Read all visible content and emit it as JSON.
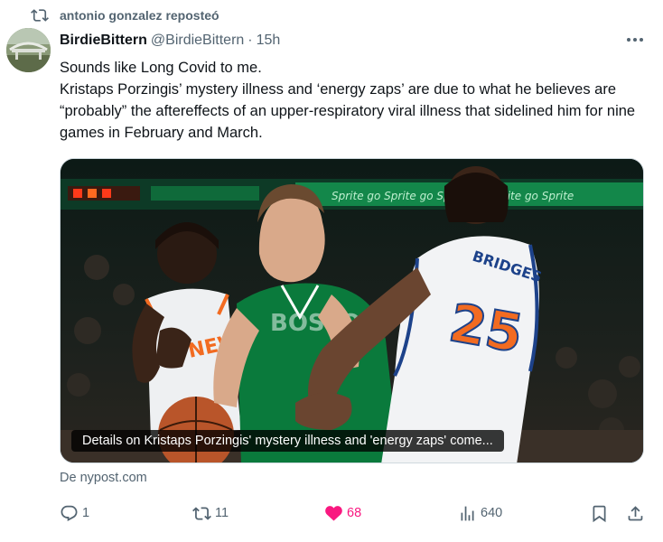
{
  "repost": {
    "label": "antonio gonzalez reposteó",
    "icon": "repost-icon"
  },
  "author": {
    "name": "BirdieBittern",
    "handle": "@BirdieBittern",
    "separator": "·",
    "time": "15h"
  },
  "post": {
    "text_lines": [
      "Sounds like Long Covid to me.",
      "Kristaps Porzingis’ mystery illness and ‘energy zaps’ are due to what he believes are “probably” the aftereffects of an upper-respiratory viral illness that sidelined him for nine games in February and March."
    ]
  },
  "card": {
    "caption": "Details on Kristaps Porzingis' mystery illness and 'energy zaps' come...",
    "jersey_name": "BRIDGES",
    "jersey_number": "25",
    "source": "De nypost.com"
  },
  "actions": {
    "replies": "1",
    "reposts": "11",
    "likes": "68",
    "views": "640",
    "like_color": "#f91880",
    "muted_color": "#536471"
  }
}
